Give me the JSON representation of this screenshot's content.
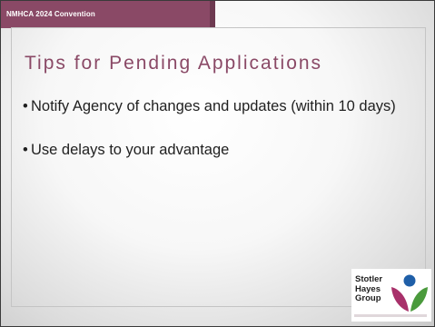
{
  "header": {
    "event_label": "NMHCA 2024 Convention"
  },
  "slide": {
    "title": "Tips for Pending Applications",
    "bullets": [
      {
        "marker": "•",
        "text": "Notify Agency of changes and updates (within 10 days)"
      },
      {
        "marker": "•",
        "text": "Use delays to your advantage"
      }
    ]
  },
  "logo": {
    "line1": "Stotler",
    "line2": "Hayes",
    "line3": "Group",
    "icon": "stotler-hayes-leaf-logo"
  },
  "colors": {
    "accent": "#8a4966",
    "accent_dark": "#6d3a50",
    "text": "#1f1f1f",
    "logo_blue": "#1f5fa8",
    "logo_green": "#4a9a3c",
    "logo_magenta": "#a8306a"
  }
}
